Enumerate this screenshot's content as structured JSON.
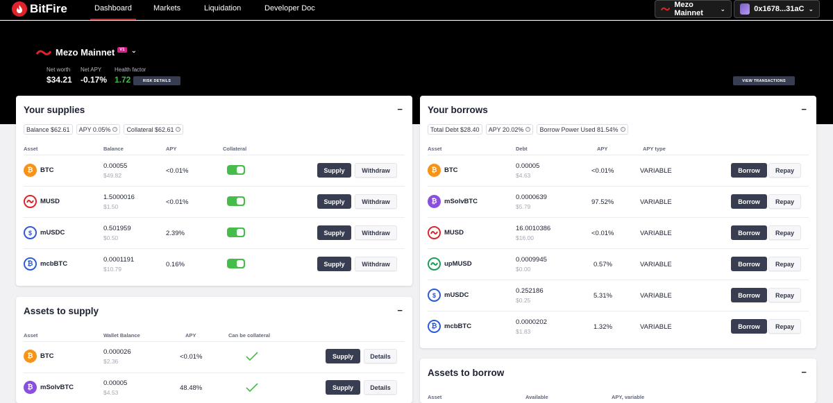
{
  "nav": {
    "brand": "BitFire",
    "links": [
      "Dashboard",
      "Markets",
      "Liquidation",
      "Developer Doc"
    ],
    "network": "Mezo Mainnet",
    "wallet": "0x1678...31aC"
  },
  "hero": {
    "market": "Mezo Mainnet",
    "badge": "V1",
    "net_worth_label": "Net worth",
    "net_worth": "$34.21",
    "net_apy_label": "Net APY",
    "net_apy": "-0.17%",
    "health_label": "Health factor",
    "health": "1.72",
    "risk_btn": "RISK DETAILS",
    "view_tx": "VIEW TRANSACTIONS"
  },
  "supplies": {
    "title": "Your supplies",
    "collapse": "−",
    "pills": {
      "balance": "Balance $62.61",
      "apy": "APY 0.05%",
      "collateral": "Collateral $62.61"
    },
    "headers": {
      "asset": "Asset",
      "balance": "Balance",
      "apy": "APY",
      "collateral": "Collateral"
    },
    "supply_label": "Supply",
    "withdraw_label": "Withdraw",
    "rows": [
      {
        "asset": "BTC",
        "amount": "0.00055",
        "usd": "$49.82",
        "apy": "<0.01%",
        "collateral": true
      },
      {
        "asset": "MUSD",
        "amount": "1.5000016",
        "usd": "$1.50",
        "apy": "<0.01%",
        "collateral": true
      },
      {
        "asset": "mUSDC",
        "amount": "0.501959",
        "usd": "$0.50",
        "apy": "2.39%",
        "collateral": true
      },
      {
        "asset": "mcbBTC",
        "amount": "0.0001191",
        "usd": "$10.79",
        "apy": "0.16%",
        "collateral": true
      }
    ]
  },
  "to_supply": {
    "title": "Assets to supply",
    "collapse": "−",
    "headers": {
      "asset": "Asset",
      "wallet": "Wallet Balance",
      "apy": "APY",
      "collateral": "Can be collateral"
    },
    "supply_label": "Supply",
    "details_label": "Details",
    "rows": [
      {
        "asset": "BTC",
        "amount": "0.000026",
        "usd": "$2.36",
        "apy": "<0.01%"
      },
      {
        "asset": "mSolvBTC",
        "amount": "0.00005",
        "usd": "$4.53",
        "apy": "48.48%"
      }
    ]
  },
  "borrows": {
    "title": "Your borrows",
    "collapse": "−",
    "pills": {
      "debt": "Total Debt $28.40",
      "apy": "APY 20.02%",
      "power": "Borrow Power Used 81.54%"
    },
    "headers": {
      "asset": "Asset",
      "debt": "Debt",
      "apy": "APY",
      "type": "APY type"
    },
    "borrow_label": "Borrow",
    "repay_label": "Repay",
    "rows": [
      {
        "asset": "BTC",
        "amount": "0.00005",
        "usd": "$4.63",
        "apy": "<0.01%",
        "type": "VARIABLE"
      },
      {
        "asset": "mSolvBTC",
        "amount": "0.0000639",
        "usd": "$5.79",
        "apy": "97.52%",
        "type": "VARIABLE"
      },
      {
        "asset": "MUSD",
        "amount": "16.0010386",
        "usd": "$16.00",
        "apy": "<0.01%",
        "type": "VARIABLE"
      },
      {
        "asset": "upMUSD",
        "amount": "0.0009945",
        "usd": "$0.00",
        "apy": "0.57%",
        "type": "VARIABLE"
      },
      {
        "asset": "mUSDC",
        "amount": "0.252186",
        "usd": "$0.25",
        "apy": "5.31%",
        "type": "VARIABLE"
      },
      {
        "asset": "mcbBTC",
        "amount": "0.0000202",
        "usd": "$1.83",
        "apy": "1.32%",
        "type": "VARIABLE"
      }
    ]
  },
  "to_borrow": {
    "title": "Assets to borrow",
    "collapse": "−",
    "headers": {
      "asset": "Asset",
      "available": "Available",
      "apy": "APY, variable"
    }
  },
  "colors": {
    "accent": "#e0232b",
    "toggle": "#46bc4b",
    "button_dark": "#383d51"
  }
}
